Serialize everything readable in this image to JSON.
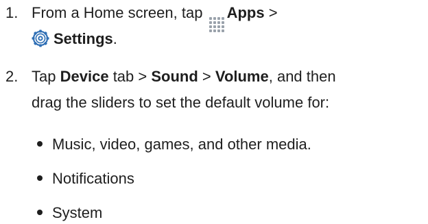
{
  "steps": [
    {
      "number": "1.",
      "line1_prefix": "From a Home screen, tap",
      "line1_bold": "Apps",
      "line1_suffix": ">",
      "line2_bold": "Settings",
      "line2_suffix": ".",
      "icons": [
        "apps-grid-icon",
        "settings-gear-icon"
      ]
    },
    {
      "number": "2.",
      "line1_prefix": "Tap",
      "line1_bold_1": "Device",
      "line1_mid_1": "tab >",
      "line1_bold_2": "Sound",
      "line1_mid_2": ">",
      "line1_bold_3": "Volume",
      "line1_suffix": ", and then",
      "line2": "drag the sliders to set the default volume for:"
    }
  ],
  "bullets": [
    "Music, video, games, and other media.",
    "Notifications",
    "System"
  ],
  "colors": {
    "text": "#1e1e1e",
    "apps_icon": "#9aa2ab",
    "settings_icon_blue": "#2f6fb5"
  }
}
